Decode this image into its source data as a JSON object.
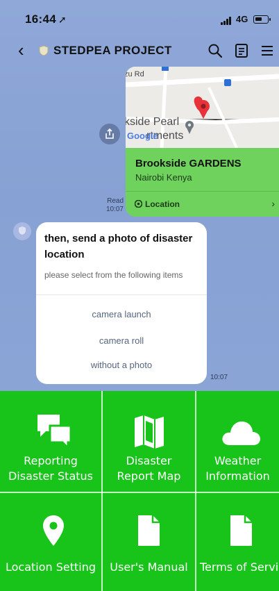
{
  "status_bar": {
    "time": "16:44",
    "network": "4G"
  },
  "header": {
    "title": "STEDPEA PROJECT"
  },
  "map": {
    "road_label": "zu Rd",
    "place_line1": "kside Pearl",
    "place_line2": "rtments",
    "google_label": "Google",
    "name": "Brookside GARDENS",
    "subtitle": "Nairobi Kenya",
    "location_label": "Location"
  },
  "read_receipt": {
    "status": "Read",
    "time": "10:07"
  },
  "message": {
    "title": "then, send a photo of disaster location",
    "subtitle": "please select from the following items",
    "options": [
      "camera launch",
      "camera roll",
      "without a photo"
    ],
    "time": "10:07"
  },
  "menu": {
    "items": [
      {
        "line1": "Reporting",
        "line2": "Disaster Status",
        "icon": "chat-bubbles-icon"
      },
      {
        "line1": "Disaster",
        "line2": "Report Map",
        "icon": "map-icon"
      },
      {
        "line1": "Weather",
        "line2": "Information",
        "icon": "cloud-icon"
      },
      {
        "line1": "Location Setting",
        "icon": "location-pin-icon"
      },
      {
        "line1": "User's Manual",
        "icon": "document-icon"
      },
      {
        "line1": "Terms of Servic",
        "icon": "document-icon"
      }
    ]
  },
  "colors": {
    "chat_background": "#8fa8d8",
    "menu_green": "#18c41a",
    "card_green": "#6fd25d",
    "pin_red": "#e8323a"
  }
}
